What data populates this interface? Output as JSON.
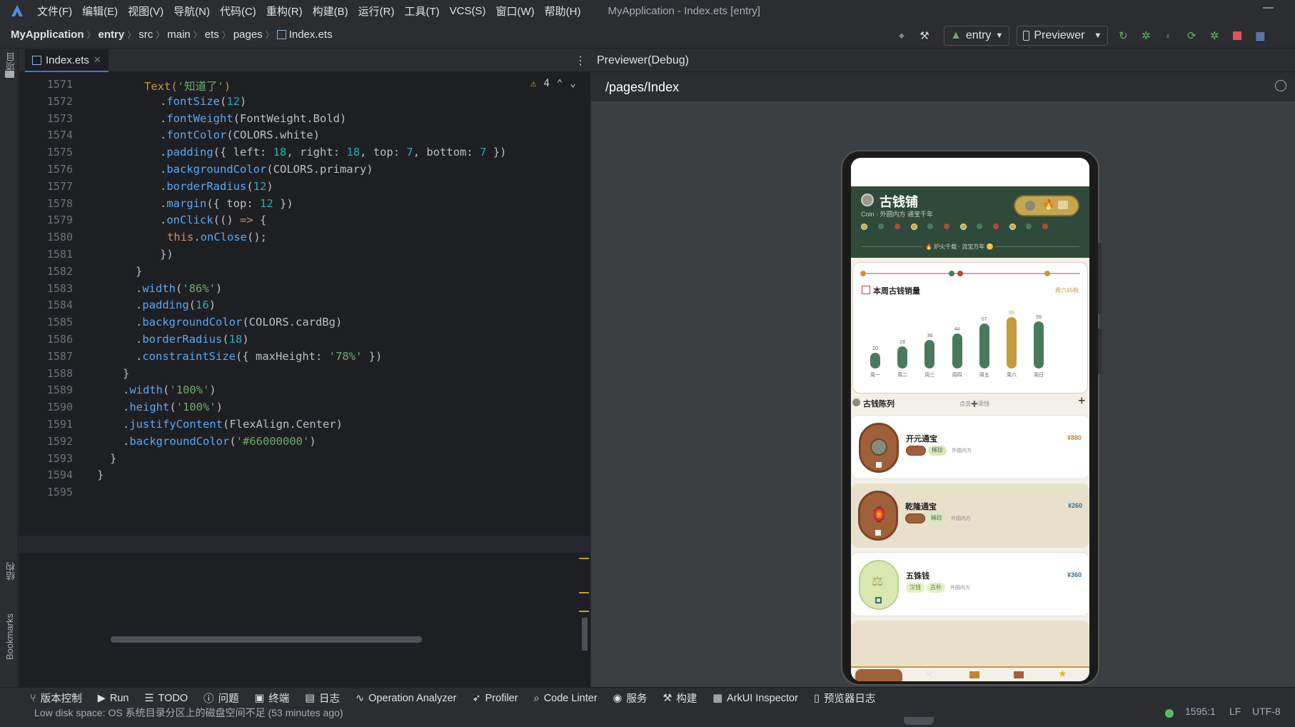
{
  "menu": {
    "items": [
      "文件(F)",
      "编辑(E)",
      "视图(V)",
      "导航(N)",
      "代码(C)",
      "重构(R)",
      "构建(B)",
      "运行(R)",
      "工具(T)",
      "VCS(S)",
      "窗口(W)",
      "帮助(H)"
    ],
    "title": "MyApplication - Index.ets [entry]",
    "minimize": "—"
  },
  "breadcrumb": [
    "MyApplication",
    "entry",
    "src",
    "main",
    "ets",
    "pages",
    "Index.ets"
  ],
  "toolbar": {
    "module": "entry",
    "device": "Previewer"
  },
  "left_stripe": {
    "project": "项目",
    "structure": "结构",
    "bookmarks": "Bookmarks"
  },
  "editor": {
    "tab": "Index.ets",
    "warnings": "4",
    "lines": [
      {
        "n": "1571",
        "t": "Text('知道了')"
      },
      {
        "n": "1572",
        "t": ".fontSize(12)"
      },
      {
        "n": "1573",
        "t": ".fontWeight(FontWeight.Bold)"
      },
      {
        "n": "1574",
        "t": ".fontColor(COLORS.white)"
      },
      {
        "n": "1575",
        "t": ".padding({ left: 18, right: 18, top: 7, bottom: 7 })"
      },
      {
        "n": "1576",
        "t": ".backgroundColor(COLORS.primary)"
      },
      {
        "n": "1577",
        "t": ".borderRadius(12)"
      },
      {
        "n": "1578",
        "t": ".margin({ top: 12 })"
      },
      {
        "n": "1579",
        "t": ".onClick(() => {"
      },
      {
        "n": "1580",
        "t": "this.onClose();"
      },
      {
        "n": "1581",
        "t": "})"
      },
      {
        "n": "1582",
        "t": "}"
      },
      {
        "n": "1583",
        "t": ".width('86%')"
      },
      {
        "n": "1584",
        "t": ".padding(16)"
      },
      {
        "n": "1585",
        "t": ".backgroundColor(COLORS.cardBg)"
      },
      {
        "n": "1586",
        "t": ".borderRadius(18)"
      },
      {
        "n": "1587",
        "t": ".constraintSize({ maxHeight: '78%' })"
      },
      {
        "n": "1588",
        "t": "}"
      },
      {
        "n": "1589",
        "t": ".width('100%')"
      },
      {
        "n": "1590",
        "t": ".height('100%')"
      },
      {
        "n": "1591",
        "t": ".justifyContent(FlexAlign.Center)"
      },
      {
        "n": "1592",
        "t": ".backgroundColor('#66000000')"
      },
      {
        "n": "1593",
        "t": "}"
      },
      {
        "n": "1594",
        "t": "}"
      },
      {
        "n": "1595",
        "t": ""
      }
    ]
  },
  "previewer": {
    "header": "Previewer(Debug)",
    "path": "/pages/Index",
    "more": "•••"
  },
  "app": {
    "title": "古钱铺",
    "subtitle": "Coin · 外圆内方 通宝千年",
    "banner": "🔥 炉火千载 · 流宝万年 🪙",
    "chart_title": "本周古钱销量",
    "chart_note": "周六65枚",
    "section_title": "古钱陈列",
    "section_hint": "点击➕添钱",
    "add": "+",
    "items": [
      {
        "name": "开元通宝",
        "price": "¥880",
        "tags": [
          "",
          "稀珍"
        ],
        "desc": "外圆内方"
      },
      {
        "name": "乾隆通宝",
        "price": "¥260",
        "tags": [
          "",
          "稀珍"
        ],
        "desc": "外圆内方"
      },
      {
        "name": "五铢钱",
        "price": "¥360",
        "tags": [
          "汉钱",
          "古朴"
        ],
        "desc": "外圆内方"
      }
    ]
  },
  "chart_data": {
    "type": "bar",
    "title": "本周古钱销量",
    "categories": [
      "周一",
      "周二",
      "周三",
      "周四",
      "周五",
      "周六",
      "周日"
    ],
    "values": [
      20,
      28,
      36,
      44,
      57,
      65,
      59
    ],
    "highlight_index": 5,
    "colors": {
      "normal": "#4a7a5c",
      "highlight": "#c49a3c"
    }
  },
  "bottom_tools": [
    "版本控制",
    "Run",
    "TODO",
    "问题",
    "终端",
    "日志",
    "Operation Analyzer",
    "Profiler",
    "Code Linter",
    "服务",
    "构建",
    "ArkUI Inspector",
    "预览器日志"
  ],
  "status": {
    "message": "Low disk space: OS 系统目录分区上的磁盘空间不足 (53 minutes ago)",
    "position": "1595:1",
    "line_sep": "LF",
    "encoding": "UTF-8"
  }
}
